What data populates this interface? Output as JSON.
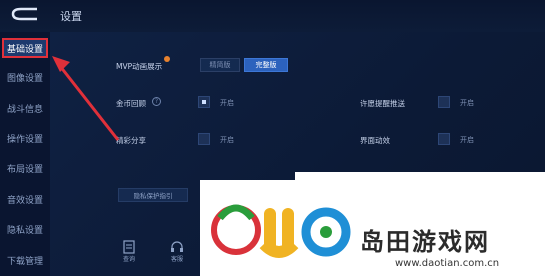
{
  "header": {
    "title": "设置"
  },
  "sidebar": {
    "items": [
      {
        "label": "基础设置",
        "active": true
      },
      {
        "label": "图像设置"
      },
      {
        "label": "战斗信息"
      },
      {
        "label": "操作设置"
      },
      {
        "label": "布局设置"
      },
      {
        "label": "音效设置"
      },
      {
        "label": "隐私设置"
      },
      {
        "label": "下载管理"
      }
    ]
  },
  "settings": {
    "mvp_label": "MVP动画展示",
    "mvp_options": [
      "精简版",
      "完整版"
    ],
    "mvp_selected": "完整版",
    "coin_label": "金币回顾",
    "coin_toggle": "开启",
    "share_label": "精彩分享",
    "share_toggle": "开启",
    "reminder_label": "许愿提醒推送",
    "reminder_toggle": "开启",
    "ui_anim_label": "界面动效",
    "ui_anim_toggle": "开启",
    "privacy_button": "隐私保护指引"
  },
  "bottom": {
    "query_label": "查询",
    "service_label": "客服"
  },
  "watermark": {
    "logo_text": "2uo",
    "site_name": "岛田游戏网",
    "url": "www.daotian.com.cn"
  },
  "colors": {
    "accent": "#2c62bd",
    "highlight_border": "#e0303a",
    "arrow": "#e0303a",
    "background": "#0c1a33"
  }
}
